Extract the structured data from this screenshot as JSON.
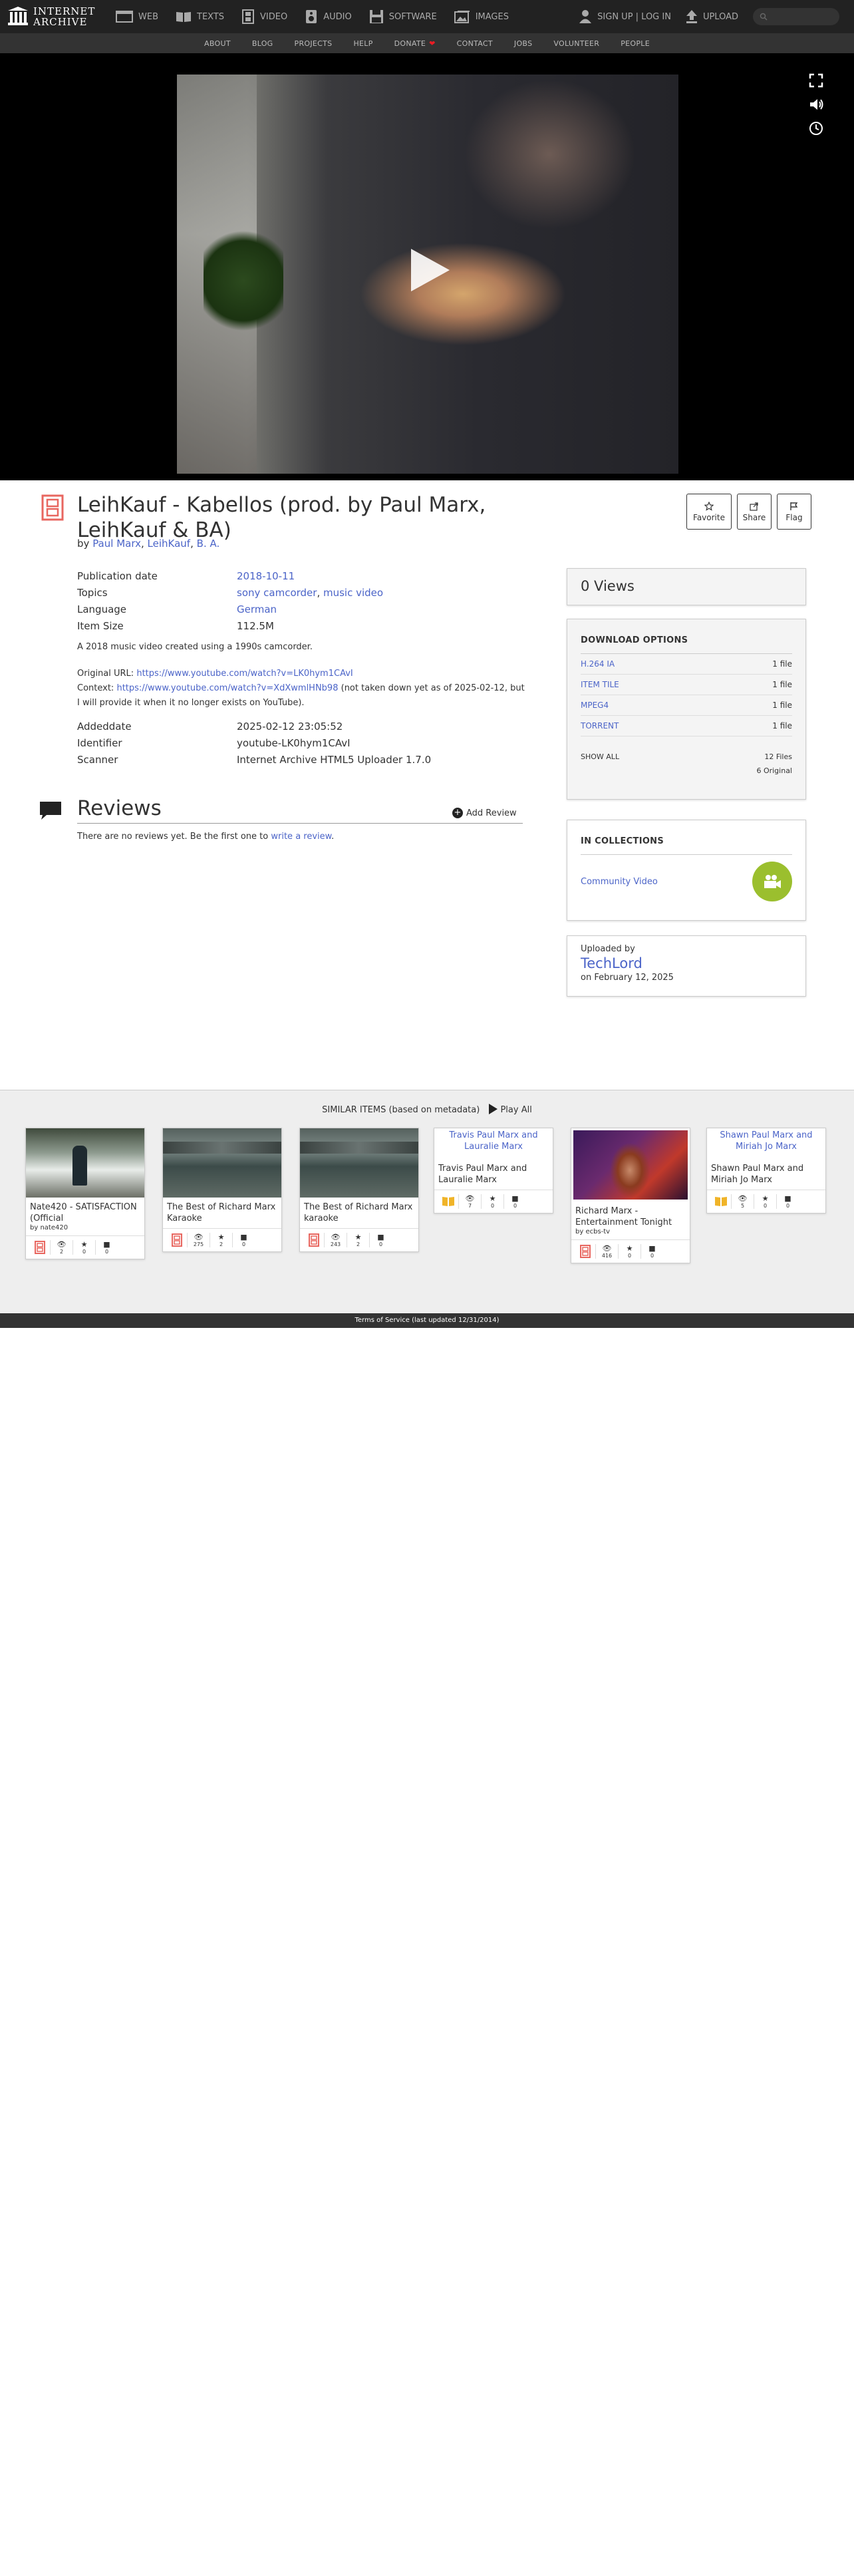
{
  "nav": {
    "logo_line1": "INTERNET",
    "logo_line2": "ARCHIVE",
    "items": [
      "WEB",
      "TEXTS",
      "VIDEO",
      "AUDIO",
      "SOFTWARE",
      "IMAGES"
    ],
    "signup": "SIGN UP | LOG IN",
    "upload": "UPLOAD"
  },
  "subnav": [
    "ABOUT",
    "BLOG",
    "PROJECTS",
    "HELP",
    "DONATE",
    "CONTACT",
    "JOBS",
    "VOLUNTEER",
    "PEOPLE"
  ],
  "item": {
    "title": "LeihKauf - Kabellos (prod. by Paul Marx, LeihKauf & BA)",
    "by_prefix": "by",
    "creators": [
      "Paul Marx",
      "LeihKauf",
      "B. A."
    ],
    "actions": [
      "Favorite",
      "Share",
      "Flag"
    ]
  },
  "meta": {
    "pubdate_label": "Publication date",
    "pubdate": "2018-10-11",
    "topics_label": "Topics",
    "topics": [
      "sony camcorder",
      "music video"
    ],
    "language_label": "Language",
    "language": "German",
    "size_label": "Item Size",
    "size": "112.5M",
    "description": "A 2018 music video created using a 1990s camcorder.",
    "original_label": "Original URL:",
    "original_url": "https://www.youtube.com/watch?v=LK0hym1CAvI",
    "context_label": "Context:",
    "context_url": "https://www.youtube.com/watch?v=XdXwmlHNb98",
    "context_note": "(not taken down yet as of 2025-02-12, but I will provide it when it no longer exists on YouTube).",
    "addeddate_label": "Addeddate",
    "addeddate": "2025-02-12 23:05:52",
    "identifier_label": "Identifier",
    "identifier": "youtube-LK0hym1CAvI",
    "scanner_label": "Scanner",
    "scanner": "Internet Archive HTML5 Uploader 1.7.0"
  },
  "reviews": {
    "title": "Reviews",
    "add": "Add Review",
    "none_text": "There are no reviews yet. Be the first one to",
    "write_link": "write a review",
    "period": "."
  },
  "views": "0 Views",
  "downloads": {
    "heading": "DOWNLOAD OPTIONS",
    "rows": [
      {
        "name": "H.264 IA",
        "count": "1 file"
      },
      {
        "name": "ITEM TILE",
        "count": "1 file"
      },
      {
        "name": "MPEG4",
        "count": "1 file"
      },
      {
        "name": "TORRENT",
        "count": "1 file"
      }
    ],
    "show_all": "SHOW ALL",
    "total": "12 Files",
    "original": "6 Original"
  },
  "collections": {
    "heading": "IN COLLECTIONS",
    "item": "Community Video"
  },
  "uploader": {
    "label": "Uploaded by",
    "name": "TechLord",
    "date": "on February 12, 2025"
  },
  "similar": {
    "heading": "SIMILAR ITEMS (based on metadata)",
    "play_all": "Play All",
    "cards": [
      {
        "title": "Nate420 - SATISFACTION (Official",
        "by": "by nate420",
        "views": "2",
        "favs": "0",
        "reviews": "0",
        "type": "video"
      },
      {
        "title": "The Best of Richard Marx Karaoke",
        "by": "",
        "views": "275",
        "favs": "2",
        "reviews": "0",
        "type": "video"
      },
      {
        "title": "The Best of Richard Marx karaoke",
        "by": "",
        "views": "243",
        "favs": "2",
        "reviews": "0",
        "type": "video"
      },
      {
        "title": "Travis Paul Marx and Lauralie Marx",
        "alt": "Travis Paul Marx and Lauralie Marx",
        "by": "",
        "views": "7",
        "favs": "0",
        "reviews": "0",
        "type": "text"
      },
      {
        "title": "Richard Marx - Entertainment Tonight",
        "by": "by ecbs-tv",
        "views": "416",
        "favs": "0",
        "reviews": "0",
        "type": "video"
      },
      {
        "title": "Shawn Paul Marx and Miriah Jo Marx",
        "alt": "Shawn Paul Marx and Miriah Jo Marx",
        "by": "",
        "views": "5",
        "favs": "0",
        "reviews": "0",
        "type": "text"
      }
    ]
  },
  "footer": "Terms of Service (last updated 12/31/2014)"
}
